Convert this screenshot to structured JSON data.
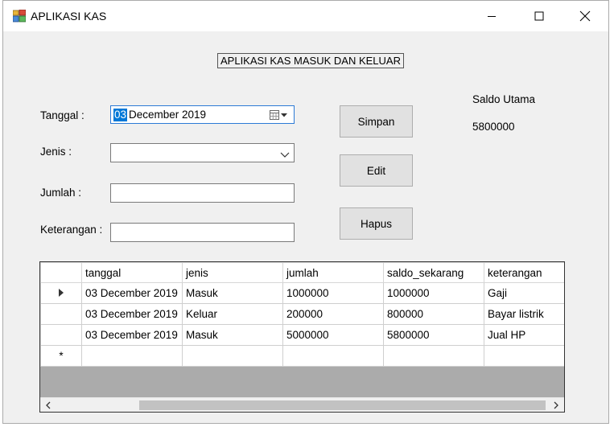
{
  "window": {
    "title": "APLIKASI KAS"
  },
  "form": {
    "header": "APLIKASI KAS MASUK DAN KELUAR",
    "tanggal_label": "Tanggal :",
    "tanggal_day": "03",
    "tanggal_rest": " December 2019",
    "jenis_label": "Jenis :",
    "jenis_value": "",
    "jumlah_label": "Jumlah :",
    "jumlah_value": "",
    "keterangan_label": "Keterangan :",
    "keterangan_value": ""
  },
  "buttons": {
    "simpan": "Simpan",
    "edit": "Edit",
    "hapus": "Hapus"
  },
  "saldo": {
    "label": "Saldo Utama",
    "value": "5800000"
  },
  "grid": {
    "columns": [
      "tanggal",
      "jenis",
      "jumlah",
      "saldo_sekarang",
      "keterangan"
    ],
    "rows": [
      {
        "tanggal": "03 December 2019",
        "jenis": "Masuk",
        "jumlah": "1000000",
        "saldo_sekarang": "1000000",
        "keterangan": "Gaji"
      },
      {
        "tanggal": "03 December 2019",
        "jenis": "Keluar",
        "jumlah": "200000",
        "saldo_sekarang": "800000",
        "keterangan": "Bayar listrik"
      },
      {
        "tanggal": "03 December 2019",
        "jenis": "Masuk",
        "jumlah": "5000000",
        "saldo_sekarang": "5800000",
        "keterangan": "Jual HP"
      }
    ],
    "current_row_marker": "▶",
    "new_row_marker": "*"
  },
  "colors": {
    "selection": "#0078d7",
    "window_bg": "#f0f0f0",
    "button_bg": "#e1e1e1"
  }
}
